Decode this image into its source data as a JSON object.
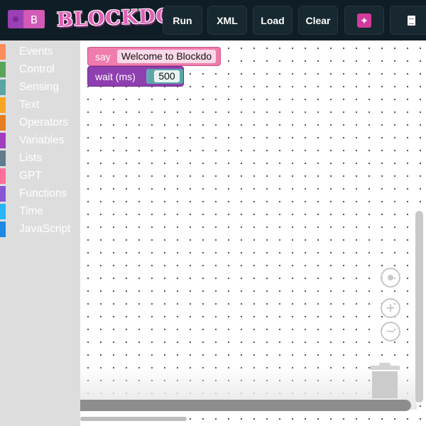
{
  "app": {
    "logo_badge": "B",
    "logo_text": "BLOCKDO"
  },
  "toolbar": {
    "run_label": "Run",
    "xml_label": "XML",
    "load_label": "Load",
    "clear_label": "Clear",
    "ai_icon": "sparkle-icon",
    "doc_icon": "document-icon"
  },
  "toolbox": {
    "categories": [
      {
        "label": "Events",
        "color": "#ff8c5a"
      },
      {
        "label": "Control",
        "color": "#5ba55b"
      },
      {
        "label": "Sensing",
        "color": "#5ba5a5"
      },
      {
        "label": "Text",
        "color": "#f5a623"
      },
      {
        "label": "Operators",
        "color": "#e67e22"
      },
      {
        "label": "Variables",
        "color": "#a23dbf"
      },
      {
        "label": "Lists",
        "color": "#607d8b"
      },
      {
        "label": "GPT",
        "color": "#ff6f9c"
      },
      {
        "label": "Functions",
        "color": "#8a56d6"
      },
      {
        "label": "Time",
        "color": "#29b6f6"
      },
      {
        "label": "JavaScript",
        "color": "#1e88e5"
      }
    ]
  },
  "workspace": {
    "blocks": {
      "say": {
        "keyword": "say",
        "text": "Welcome to Blockdo",
        "color": "#f07cad"
      },
      "wait": {
        "keyword": "wait (ms)",
        "value": "500",
        "color": "#8e3fb0"
      }
    },
    "controls": {
      "reset_icon": "recenter-icon",
      "zoom_in_icon": "zoom-in-icon",
      "zoom_out_icon": "zoom-out-icon",
      "trash_icon": "trash-icon"
    }
  }
}
